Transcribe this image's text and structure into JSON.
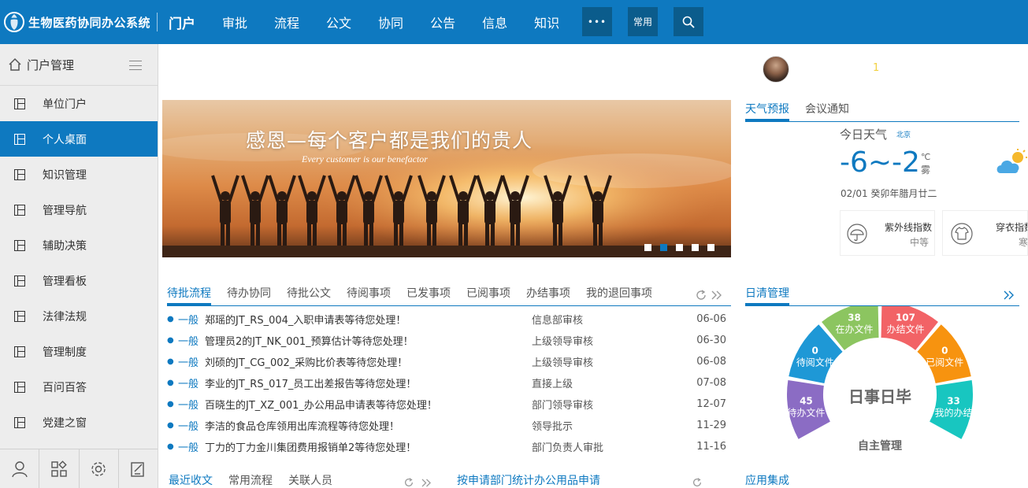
{
  "app": {
    "title": "生物医药协同办公系统"
  },
  "nav": {
    "items": [
      "门户",
      "审批",
      "流程",
      "公文",
      "协同",
      "公告",
      "信息",
      "知识"
    ],
    "more_label": "•••",
    "common_label": "常用"
  },
  "sidebar": {
    "title": "门户管理",
    "items": [
      {
        "label": "单位门户",
        "active": false
      },
      {
        "label": "个人桌面",
        "active": true
      },
      {
        "label": "知识管理",
        "active": false
      },
      {
        "label": "管理导航",
        "active": false
      },
      {
        "label": "辅助决策",
        "active": false
      },
      {
        "label": "管理看板",
        "active": false
      },
      {
        "label": "法律法规",
        "active": false
      },
      {
        "label": "管理制度",
        "active": false
      },
      {
        "label": "百问百答",
        "active": false
      },
      {
        "label": "党建之窗",
        "active": false
      }
    ]
  },
  "banner": {
    "title": "感恩—每个客户都是我们的贵人",
    "subtitle": "Every customer is our benefactor",
    "slides": 5,
    "active_slide": 2
  },
  "user": {
    "badge": "1"
  },
  "weather_tabs": [
    "天气预报",
    "会议通知"
  ],
  "weather": {
    "label": "今日天气",
    "city": "北京",
    "temp": "-6~-2",
    "unit": "℃",
    "condition": "雾",
    "date": "02/01 癸卯年腊月廿二",
    "uv_label": "紫外线指数",
    "uv_value": "中等",
    "dress_label": "穿衣指数",
    "dress_value": "寒冷"
  },
  "todo_tabs": [
    "待批流程",
    "待办协同",
    "待批公文",
    "待阅事项",
    "已发事项",
    "已阅事项",
    "办结事项",
    "我的退回事项"
  ],
  "todo_items": [
    {
      "level": "一般",
      "title": "郑瑶的JT_RS_004_入职申请表等待您处理！",
      "node": "信息部审核",
      "date": "06-06"
    },
    {
      "level": "一般",
      "title": "管理员2的JT_NK_001_预算估计等待您处理！",
      "node": "上级领导审核",
      "date": "06-30"
    },
    {
      "level": "一般",
      "title": "刘硕的JT_CG_002_采购比价表等待您处理！",
      "node": "上级领导审核",
      "date": "06-08"
    },
    {
      "level": "一般",
      "title": "李业的JT_RS_017_员工出差报告等待您处理！",
      "node": "直接上级",
      "date": "07-08"
    },
    {
      "level": "一般",
      "title": "百晓生的JT_XZ_001_办公用品申请表等待您处理！",
      "node": "部门领导审核",
      "date": "12-07"
    },
    {
      "level": "一般",
      "title": "李洁的食品仓库领用出库流程等待您处理！",
      "node": "领导批示",
      "date": "11-29"
    },
    {
      "level": "一般",
      "title": "丁力的丁力金川集团费用报销单2等待您处理！",
      "node": "部门负责人审批",
      "date": "11-16"
    }
  ],
  "daily": {
    "tab": "日清管理",
    "center_title": "日事日毕",
    "center_sub": "自主管理",
    "segments": [
      {
        "count": "45",
        "label": "待办文件",
        "color": "#8b6cc4"
      },
      {
        "count": "0",
        "label": "待阅文件",
        "color": "#1e98d6"
      },
      {
        "count": "38",
        "label": "在办文件",
        "color": "#8cc560"
      },
      {
        "count": "107",
        "label": "办结文件",
        "color": "#f26366"
      },
      {
        "count": "0",
        "label": "已阅文件",
        "color": "#f7930f"
      },
      {
        "count": "33",
        "label": "我的办结",
        "color": "#18c6c0"
      }
    ]
  },
  "bottom": {
    "left_tabs": [
      "最近收文",
      "常用流程",
      "关联人员"
    ],
    "middle_title": "按申请部门统计办公用品申请",
    "right_title": "应用集成"
  },
  "colors": {
    "brand": "#0e79c0",
    "nav_button": "#0b5c8c"
  }
}
